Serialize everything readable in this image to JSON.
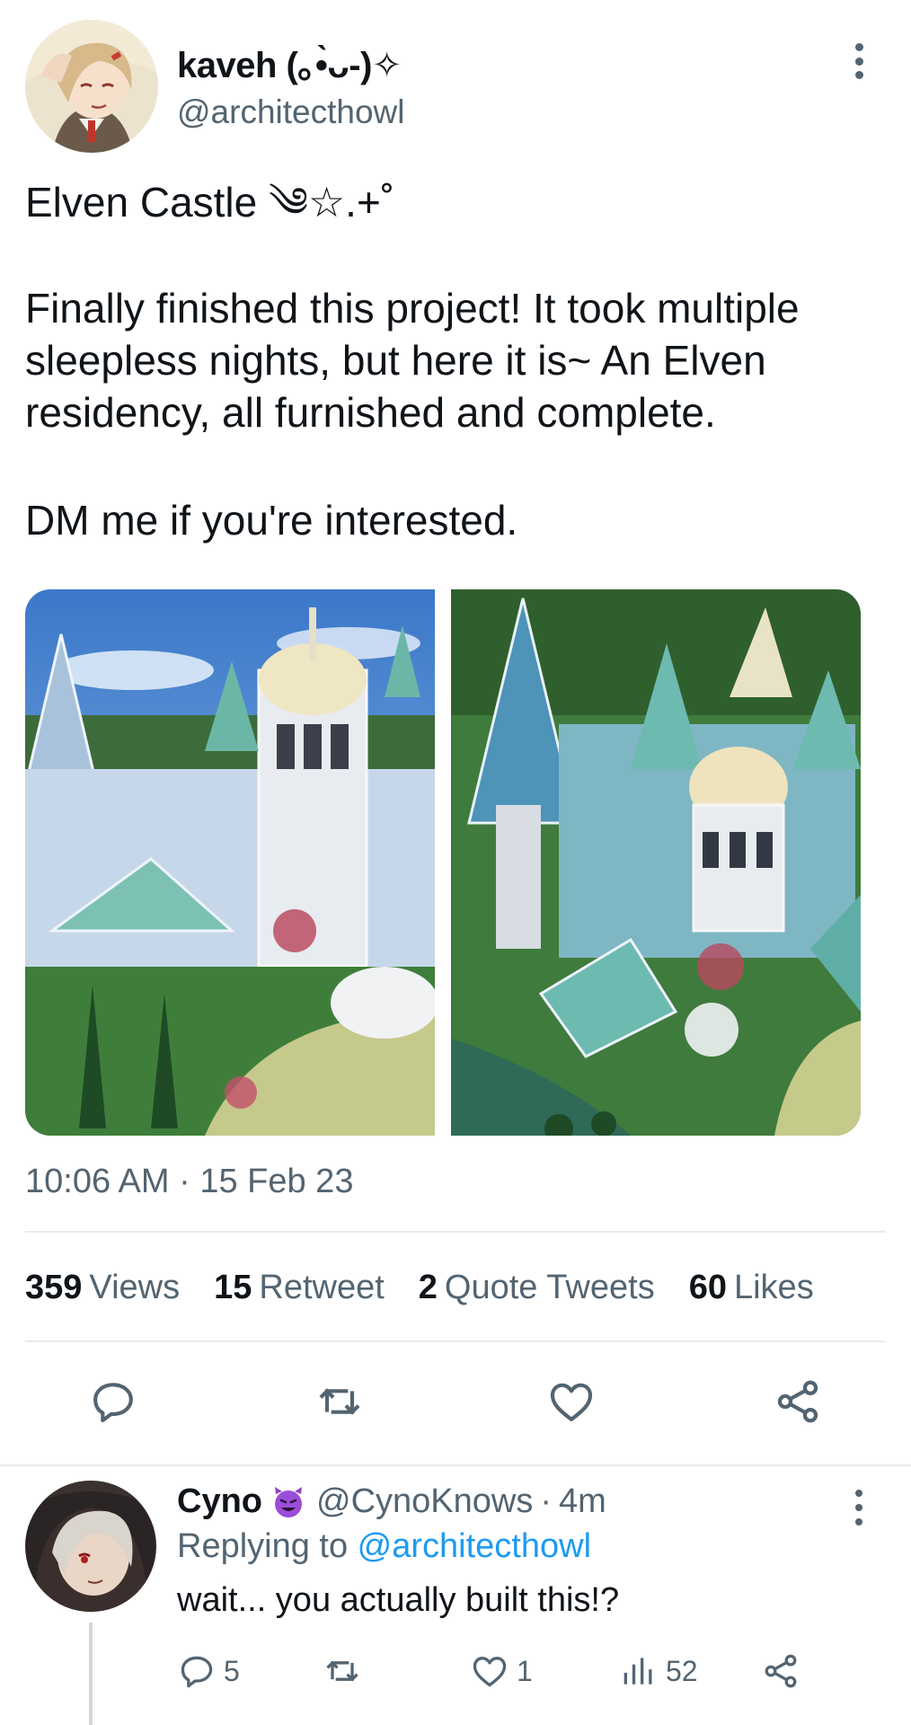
{
  "tweet": {
    "author": {
      "display_name": "kaveh (｡•̀ᴗ-)✧",
      "handle": "@architecthowl"
    },
    "lines": {
      "title": "Elven Castle ༄☆.+˚",
      "para1_l1": "Finally finished this project! It took multiple",
      "para1_l2": "sleepless nights, but here it is~ An Elven",
      "para1_l3": "residency, all furnished and complete.",
      "para2": "DM me if you're interested."
    },
    "timestamp": "10:06 AM · 15 Feb 23",
    "stats": [
      {
        "count": "359",
        "label": "Views"
      },
      {
        "count": "15",
        "label": "Retweet"
      },
      {
        "count": "2",
        "label": "Quote Tweets"
      },
      {
        "count": "60",
        "label": "Likes"
      }
    ],
    "actions": [
      "reply-icon",
      "retweet-icon",
      "like-icon",
      "share-icon"
    ]
  },
  "reply": {
    "name": "Cyno",
    "emoji_icon": "smiling-devil-icon",
    "handle": "@CynoKnows",
    "separator": "·",
    "time": "4m",
    "replying_prefix": "Replying to ",
    "replying_handle": "@architecthowl",
    "text": "wait... you actually built this!?",
    "actions": {
      "replies": "5",
      "retweets": "",
      "likes": "1",
      "views": "52"
    }
  },
  "colors": {
    "text": "#0f1419",
    "secondary": "#536471",
    "link": "#1d9bf0",
    "divider": "#e6ecf0"
  }
}
